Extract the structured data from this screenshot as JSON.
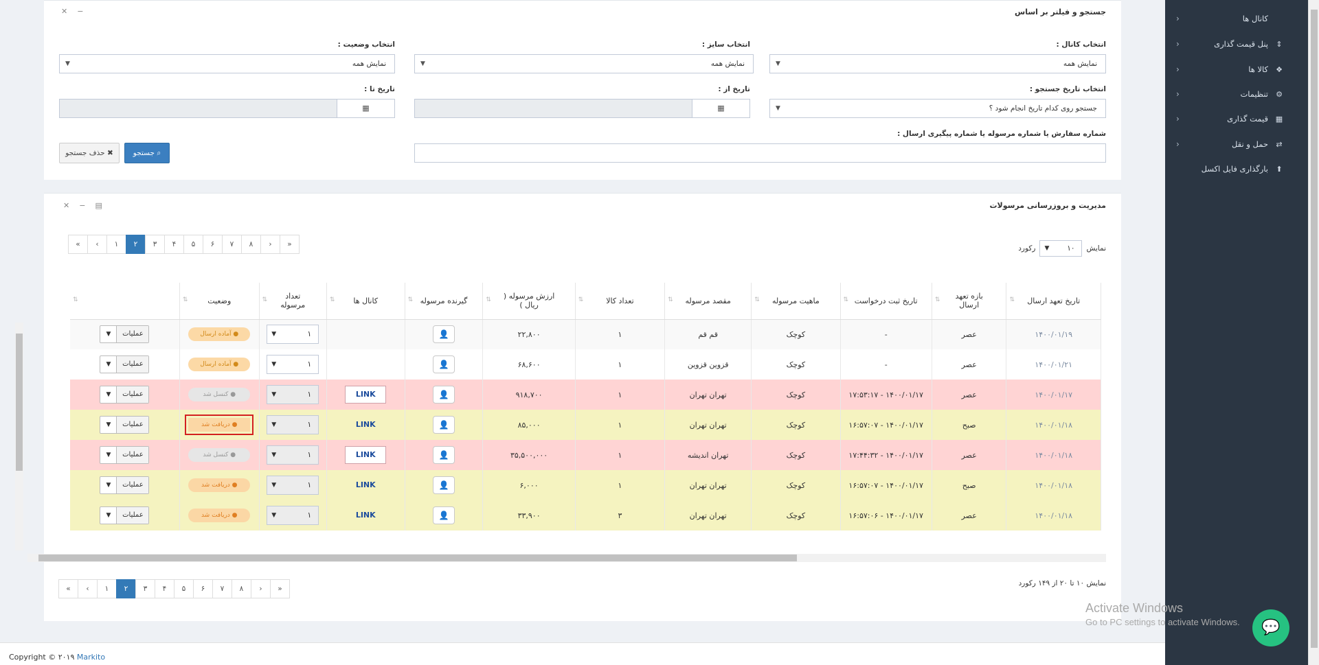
{
  "sidebar": {
    "items": [
      {
        "label": "کانال ها",
        "icon": "diamond-icon",
        "glyph": ""
      },
      {
        "label": "پنل قیمت گذاری",
        "icon": "sort-icon",
        "glyph": "⇕"
      },
      {
        "label": "کالا ها",
        "icon": "cubes-icon",
        "glyph": "❖"
      },
      {
        "label": "تنظیمات",
        "icon": "gear-icon",
        "glyph": "⚙"
      },
      {
        "label": "قیمت گذاری",
        "icon": "chart-icon",
        "glyph": "▦"
      },
      {
        "label": "حمل و نقل",
        "icon": "exchange-icon",
        "glyph": "⇄"
      },
      {
        "label": "بارگذاری فایل اکسل",
        "icon": "upload-user-icon",
        "glyph": "⬆"
      }
    ]
  },
  "filter": {
    "title": "جستجو و فیلتر بر اساس",
    "channel_label": "انتخاب کانال :",
    "channel_value": "نمایش همه",
    "size_label": "انتخاب سایز :",
    "size_value": "نمایش همه",
    "status_label": "انتخاب وضعیت :",
    "status_value": "نمایش همه",
    "date_search_label": "انتخاب تاریخ جستجو :",
    "date_search_value": "جستجو روی کدام تاریخ انجام شود ؟",
    "date_from_label": "تاریخ از :",
    "date_to_label": "تاریخ تا :",
    "order_label": "شماره سفارش یا شماره مرسوله یا شماره پیگیری ارسال :",
    "search_button": "جستجو",
    "clear_button": "حذف جستجو"
  },
  "shipments": {
    "title": "مدیریت و بروزرسانی مرسولات",
    "show_label": "نمایش",
    "page_size": "۱۰",
    "records_label": "رکورد",
    "pages": [
      "«",
      "‹",
      "۱",
      "۲",
      "۳",
      "۴",
      "۵",
      "۶",
      "۷",
      "۸",
      "›",
      "»"
    ],
    "active_page": "۲",
    "columns": [
      "تاریخ تعهد ارسال",
      "بازه تعهد ارسال",
      "تاریخ ثبت درخواست",
      "ماهیت مرسوله",
      "مقصد مرسوله",
      "تعداد کالا",
      "ارزش مرسوله ( ریال )",
      "گیرنده مرسوله",
      "کانال ها",
      "تعداد مرسوله",
      "وضعیت",
      ""
    ],
    "ops_label": "عملیات",
    "rows": [
      {
        "date": "۱۴۰۰/۰۱/۱۹",
        "slot": "عصر",
        "created": "-",
        "type": "کوچک",
        "dest": "قم قم",
        "count": "۱",
        "value": "۲۲,۸۰۰",
        "channel": "",
        "qty": "۱",
        "status": "آماده ارسال",
        "status_kind": "ready",
        "row_kind": "r0"
      },
      {
        "date": "۱۴۰۰/۰۱/۲۱",
        "slot": "عصر",
        "created": "-",
        "type": "کوچک",
        "dest": "قزوین قزوین",
        "count": "۱",
        "value": "۶۸,۶۰۰",
        "channel": "",
        "qty": "۱",
        "status": "آماده ارسال",
        "status_kind": "ready",
        "row_kind": "r1"
      },
      {
        "date": "۱۴۰۰/۰۱/۱۷",
        "slot": "عصر",
        "created": "۱۴۰۰/۰۱/۱۷ - ۱۷:۵۳:۱۷",
        "type": "کوچک",
        "dest": "تهران تهران",
        "count": "۱",
        "value": "۹۱۸,۷۰۰",
        "channel": "LINK",
        "qty": "۱",
        "status": "کنسل شد",
        "status_kind": "cancel",
        "row_kind": "red"
      },
      {
        "date": "۱۴۰۰/۰۱/۱۸",
        "slot": "صبح",
        "created": "۱۴۰۰/۰۱/۱۷ - ۱۶:۵۷:۰۷",
        "type": "کوچک",
        "dest": "تهران تهران",
        "count": "۱",
        "value": "۸۵,۰۰۰",
        "channel": "LINK",
        "qty": "۱",
        "status": "دریافت شد",
        "status_kind": "recv",
        "row_kind": "yel",
        "highlight": true
      },
      {
        "date": "۱۴۰۰/۰۱/۱۸",
        "slot": "عصر",
        "created": "۱۴۰۰/۰۱/۱۷ - ۱۷:۴۴:۳۲",
        "type": "کوچک",
        "dest": "تهران اندیشه",
        "count": "۱",
        "value": "۳۵,۵۰۰,۰۰۰",
        "channel": "LINK",
        "qty": "۱",
        "status": "کنسل شد",
        "status_kind": "cancel",
        "row_kind": "red"
      },
      {
        "date": "۱۴۰۰/۰۱/۱۸",
        "slot": "صبح",
        "created": "۱۴۰۰/۰۱/۱۷ - ۱۶:۵۷:۰۷",
        "type": "کوچک",
        "dest": "تهران تهران",
        "count": "۱",
        "value": "۶,۰۰۰",
        "channel": "LINK",
        "qty": "۱",
        "status": "دریافت شد",
        "status_kind": "recv",
        "row_kind": "yel"
      },
      {
        "date": "۱۴۰۰/۰۱/۱۸",
        "slot": "عصر",
        "created": "۱۴۰۰/۰۱/۱۷ - ۱۶:۵۷:۰۶",
        "type": "کوچک",
        "dest": "تهران تهران",
        "count": "۳",
        "value": "۳۳,۹۰۰",
        "channel": "LINK",
        "qty": "۱",
        "status": "دریافت شد",
        "status_kind": "recv",
        "row_kind": "yel"
      }
    ],
    "summary": "نمایش ۱۰ تا ۲۰ از ۱۴۹ رکورد"
  },
  "footer": {
    "copyright": "Copyright © ۲۰۱۹",
    "brand": "Markito"
  },
  "watermark": {
    "line1": "Activate Windows",
    "line2": "Go to PC settings to activate Windows."
  },
  "colors": {
    "sidebar": "#2b3643",
    "primary": "#337ab7",
    "cancel_row": "#ffd4d4",
    "received_row": "#f5f3c0",
    "chat": "#26c281"
  }
}
